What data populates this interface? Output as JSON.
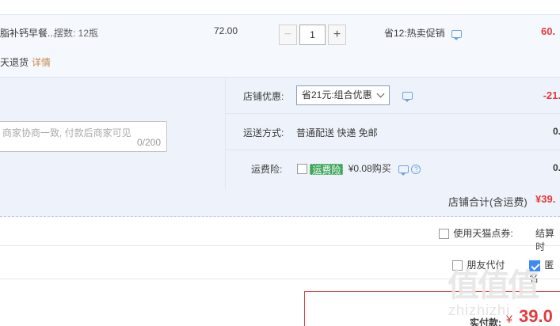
{
  "product": {
    "name": "脂补钙早餐...",
    "spec": "摆数: 12瓶",
    "price": "72.00",
    "quantity": "1",
    "minus": "−",
    "plus": "+",
    "promo": "省12:热卖促销",
    "line_total": "60.",
    "return_policy": "天退货",
    "details_link": "详情"
  },
  "shop": {
    "discount_label": "店铺优惠:",
    "coupon_selected": "省21元:组合优惠",
    "discount_value": "-21.",
    "shipping_label": "运送方式:",
    "shipping_method": "普通配送 快递 免邮",
    "shipping_value": "0.",
    "insurance_label": "运费险:",
    "insurance_badge": "运费险",
    "insurance_price": "¥0.08购买",
    "insurance_value": "0.",
    "help_glyph": "?",
    "message_placeholder": "商家协商一致, 付款后商家可见",
    "message_counter": "0/200",
    "total_label": "店铺合计(含运费)",
    "total_value": "¥39."
  },
  "footer": {
    "tmall_coupon_label": "使用天猫点券:",
    "settle_label": "结算时",
    "friend_pay_label": "朋友代付",
    "anonymous_label": "匿名",
    "pay_label": "实付款:",
    "pay_currency": "¥",
    "pay_amount": "39.0"
  },
  "watermark": {
    "logo": "值值值",
    "text": "zhizhizhi"
  },
  "colors": {
    "accent_red": "#e4393c",
    "panel_bg": "#eef3fb",
    "link_orange": "#c68a4d",
    "checkbox_blue": "#3d8bf3",
    "badge_green": "#3fa75c"
  },
  "icons": [
    "minus-icon",
    "plus-icon",
    "chat-icon",
    "chevron-down-icon",
    "help-icon",
    "checkmark-icon"
  ]
}
